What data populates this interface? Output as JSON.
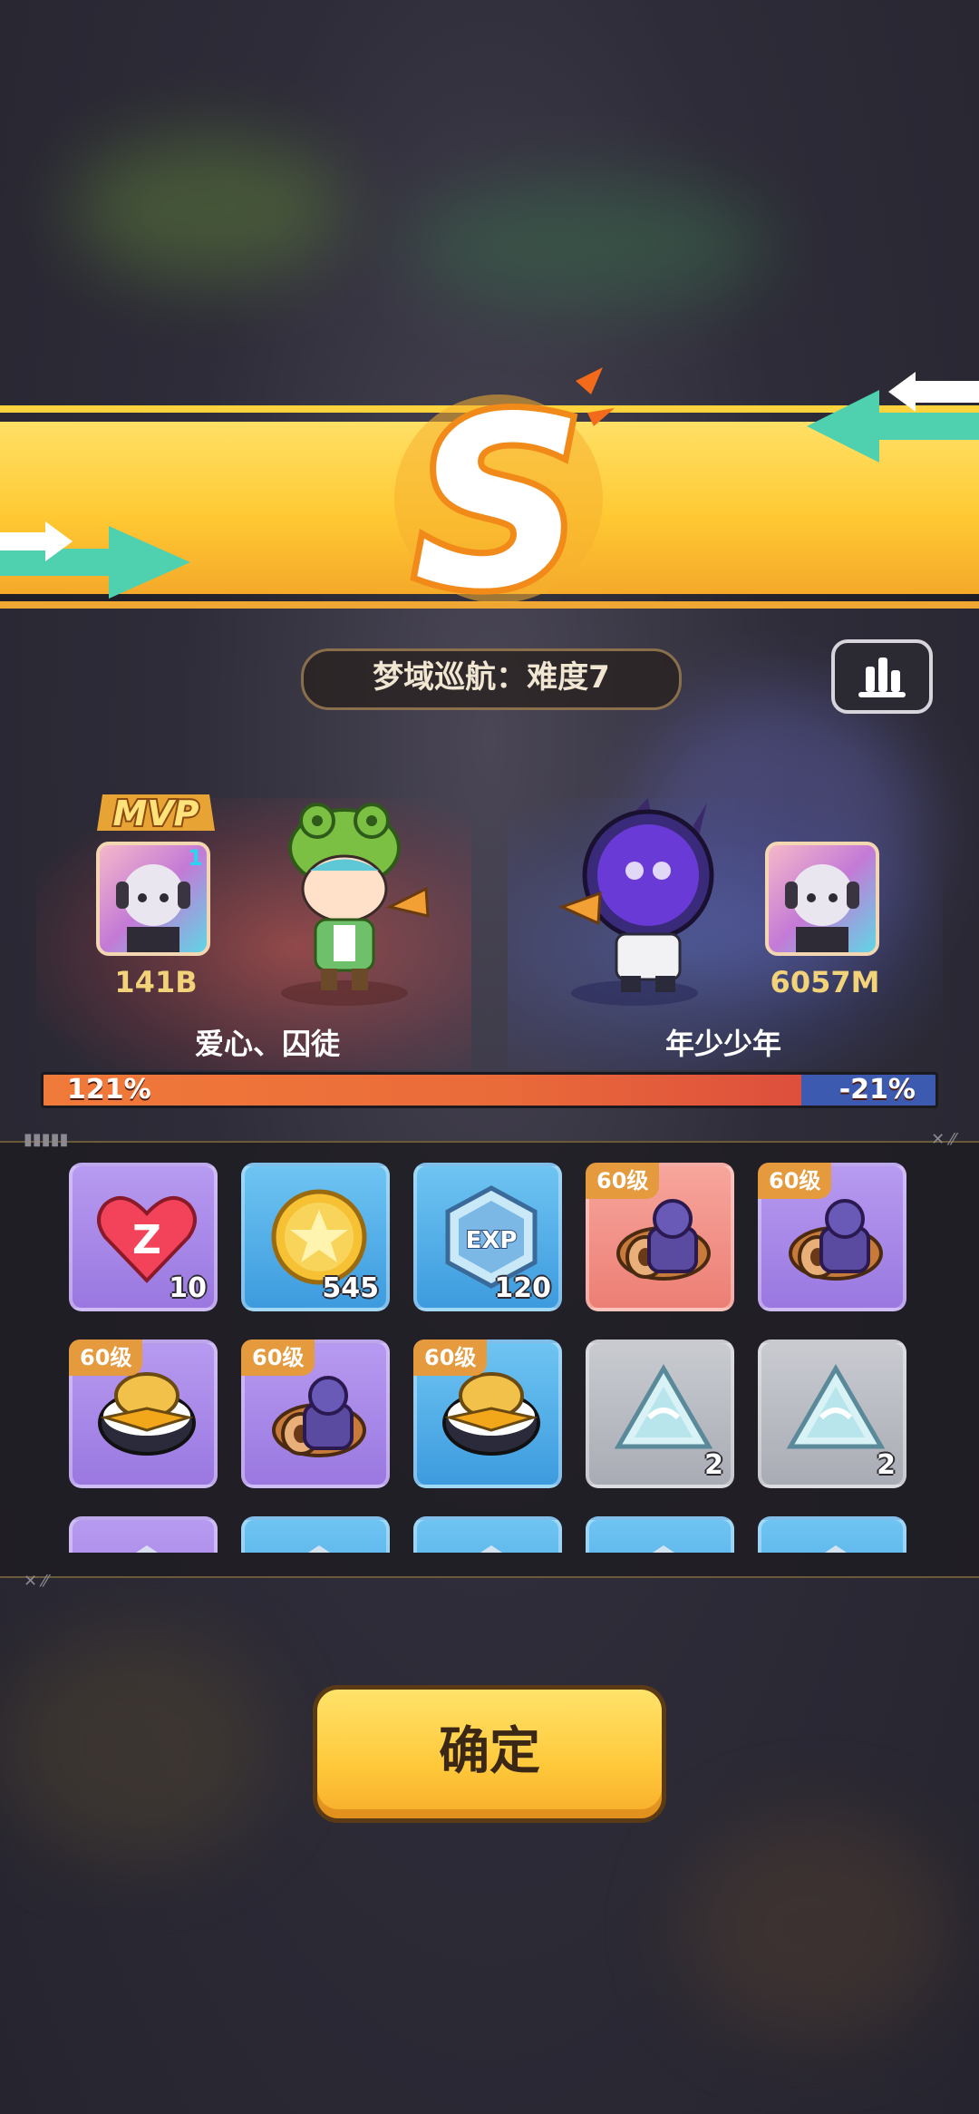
{
  "result": {
    "rank": "S"
  },
  "dungeon": {
    "title": "梦域巡航：难度7"
  },
  "mvp": {
    "label": "MVP"
  },
  "players": [
    {
      "name_group": "爱心、囚徒",
      "score": "141B",
      "avatar_level": "1"
    },
    {
      "name_group": "年少少年",
      "score": "6057M"
    }
  ],
  "contribution": {
    "left_label": "121%",
    "right_label": "-21%",
    "left_share": 0.85
  },
  "rewards": [
    {
      "kind": "heart-ticket",
      "count": "10",
      "level": "",
      "color": "purple"
    },
    {
      "kind": "gold-coin",
      "count": "545",
      "level": "",
      "color": "blue"
    },
    {
      "kind": "exp-badge",
      "count": "120",
      "level": "",
      "color": "blue"
    },
    {
      "kind": "cat-scroll",
      "count": "",
      "level": "60级",
      "color": "red"
    },
    {
      "kind": "cat-scroll",
      "count": "",
      "level": "60级",
      "color": "purple"
    },
    {
      "kind": "bird-helmet",
      "count": "",
      "level": "60级",
      "color": "purple"
    },
    {
      "kind": "cat-scroll",
      "count": "",
      "level": "60级",
      "color": "purple"
    },
    {
      "kind": "bird-helmet",
      "count": "",
      "level": "60级",
      "color": "blue"
    },
    {
      "kind": "ice-crystal",
      "count": "2",
      "level": "",
      "color": "gray"
    },
    {
      "kind": "ice-crystal",
      "count": "2",
      "level": "",
      "color": "gray"
    },
    {
      "kind": "partial",
      "count": "",
      "level": "",
      "color": "purple"
    },
    {
      "kind": "partial",
      "count": "",
      "level": "",
      "color": "blue"
    },
    {
      "kind": "partial",
      "count": "",
      "level": "",
      "color": "blue"
    },
    {
      "kind": "partial",
      "count": "",
      "level": "",
      "color": "blue"
    },
    {
      "kind": "partial",
      "count": "",
      "level": "",
      "color": "blue"
    }
  ],
  "confirm": {
    "label": "确定"
  },
  "colors": {
    "banner": "#ffc933",
    "accent_orange": "#f07a3a",
    "button": "#ffc83a"
  }
}
